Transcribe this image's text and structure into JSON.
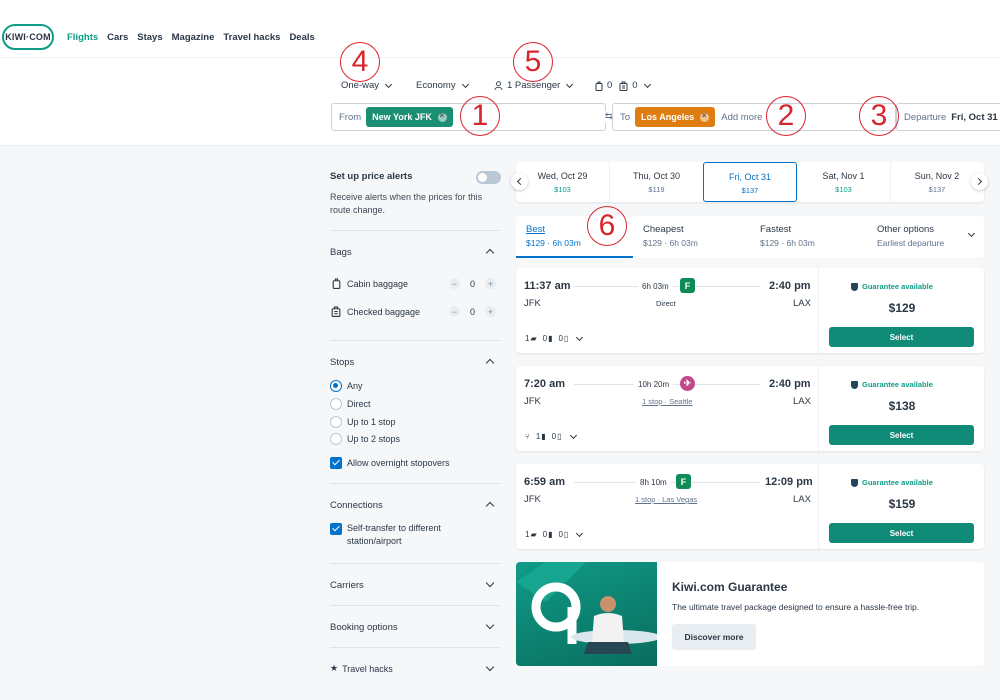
{
  "brand": {
    "logo": "KIWI·COM"
  },
  "nav": {
    "items": [
      "Flights",
      "Cars",
      "Stays",
      "Magazine",
      "Travel hacks",
      "Deals"
    ]
  },
  "search": {
    "trip_type": "One-way",
    "cabin": "Economy",
    "passengers": "1 Passenger",
    "cabin_bags": "0",
    "checked_bags": "0",
    "from_label": "From",
    "from_value": "New York JFK",
    "to_label": "To",
    "to_value": "Los Angeles",
    "to_add": "Add more",
    "departure_label": "Departure",
    "departure_value": "Fri, Oct 31"
  },
  "annotations": [
    "1",
    "2",
    "3",
    "4",
    "5",
    "6"
  ],
  "sidebar": {
    "alerts_title": "Set up price alerts",
    "alerts_text": "Receive alerts when the prices for this route change.",
    "bags_title": "Bags",
    "cabin_baggage": "Cabin baggage",
    "cabin_count": "0",
    "checked_baggage": "Checked baggage",
    "checked_count": "0",
    "stops_title": "Stops",
    "stops": [
      "Any",
      "Direct",
      "Up to 1 stop",
      "Up to 2 stops"
    ],
    "overnight": "Allow overnight stopovers",
    "connections_title": "Connections",
    "self_transfer": "Self-transfer to different station/airport",
    "carriers_title": "Carriers",
    "booking_title": "Booking options",
    "travel_hacks_title": "Travel hacks"
  },
  "dates": [
    {
      "day": "Wed, Oct 29",
      "price": "$103"
    },
    {
      "day": "Thu, Oct 30",
      "price": "$119"
    },
    {
      "day": "Fri, Oct 31",
      "price": "$137"
    },
    {
      "day": "Sat, Nov 1",
      "price": "$103"
    },
    {
      "day": "Sun, Nov 2",
      "price": "$137"
    }
  ],
  "sort_tabs": [
    {
      "title": "Best",
      "sub": "$129 · 6h 03m"
    },
    {
      "title": "Cheapest",
      "sub": "$129 · 6h 03m"
    },
    {
      "title": "Fastest",
      "sub": "$129 · 6h 03m"
    },
    {
      "title": "Other options",
      "sub": "Earliest departure"
    }
  ],
  "flights": [
    {
      "dep": "11:37 am",
      "arr": "2:40 pm",
      "from": "JFK",
      "to": "LAX",
      "duration": "6h 03m",
      "stops": "Direct",
      "bag1": "1",
      "bag2": "0",
      "bag3": "0",
      "guarantee": "Guarantee available",
      "price": "$129",
      "select": "Select",
      "carrier_color": "#0f8b57"
    },
    {
      "dep": "7:20 am",
      "arr": "2:40 pm",
      "from": "JFK",
      "to": "LAX",
      "duration": "10h 20m",
      "stops": "1 stop · Seattle",
      "bag1": "1",
      "bag2": "0",
      "bag3": "",
      "guarantee": "Guarantee available",
      "price": "$138",
      "select": "Select",
      "carrier_color": "#c2488c"
    },
    {
      "dep": "6:59 am",
      "arr": "12:09 pm",
      "from": "JFK",
      "to": "LAX",
      "duration": "8h 10m",
      "stops": "1 stop · Las Vegas",
      "bag1": "1",
      "bag2": "0",
      "bag3": "0",
      "guarantee": "Guarantee available",
      "price": "$159",
      "select": "Select",
      "carrier_color": "#0f8b57"
    }
  ],
  "banner": {
    "title": "Kiwi.com Guarantee",
    "text": "The ultimate travel package designed to ensure a hassle-free trip.",
    "button": "Discover more"
  },
  "colors": {
    "accent": "#0f9c87",
    "from_chip": "#1b8f74",
    "to_chip": "#e07d10",
    "select": "#0f8b77",
    "selected_blue": "#0172cb",
    "annotation": "#d8262f"
  }
}
